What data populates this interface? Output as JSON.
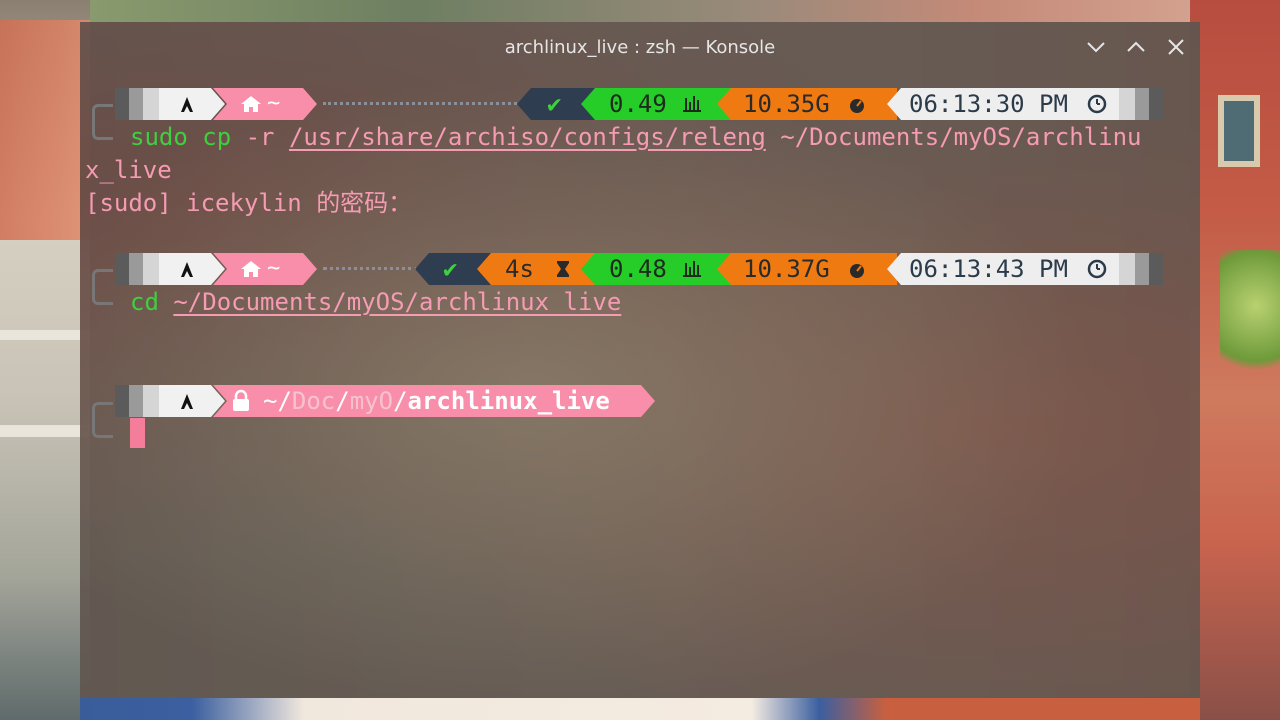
{
  "window": {
    "title": "archlinux_live : zsh — Konsole"
  },
  "prompts": [
    {
      "home_icon": "home-icon",
      "dir": "~",
      "status": "✔",
      "load": "0.49",
      "ram": "10.35G",
      "time": "06:13:30 PM"
    },
    {
      "home_icon": "home-icon",
      "dir": "~",
      "status": "✔",
      "duration": "4s",
      "load": "0.48",
      "ram": "10.37G",
      "time": "06:13:43 PM"
    },
    {
      "lock_icon": "lock-icon",
      "path_prefix": "~/",
      "path_a": "Doc",
      "sep1": "/",
      "path_b": "myO",
      "sep2": "/",
      "path_current": "archlinux_live"
    }
  ],
  "commands": {
    "cmd1_sudo": "sudo",
    "cmd1_cp": "cp",
    "cmd1_flag": "-r",
    "cmd1_src": "/usr/share/archiso/configs/releng",
    "cmd1_dst_a": "~/Documents/myOS/archlinu",
    "cmd1_dst_b": "x_live",
    "sudo_prompt": "[sudo] icekylin 的密码：",
    "cmd2_cd": "cd",
    "cmd2_path": "~/Documents/myOS/archlinux_live"
  },
  "colors": {
    "prompt_pink": "#f88ea9",
    "success_green": "#26cc28",
    "ram_orange": "#f07a12",
    "status_dark": "#2e3d4f",
    "command_green": "#3fcf3f",
    "path_pink": "#f59bb3"
  }
}
